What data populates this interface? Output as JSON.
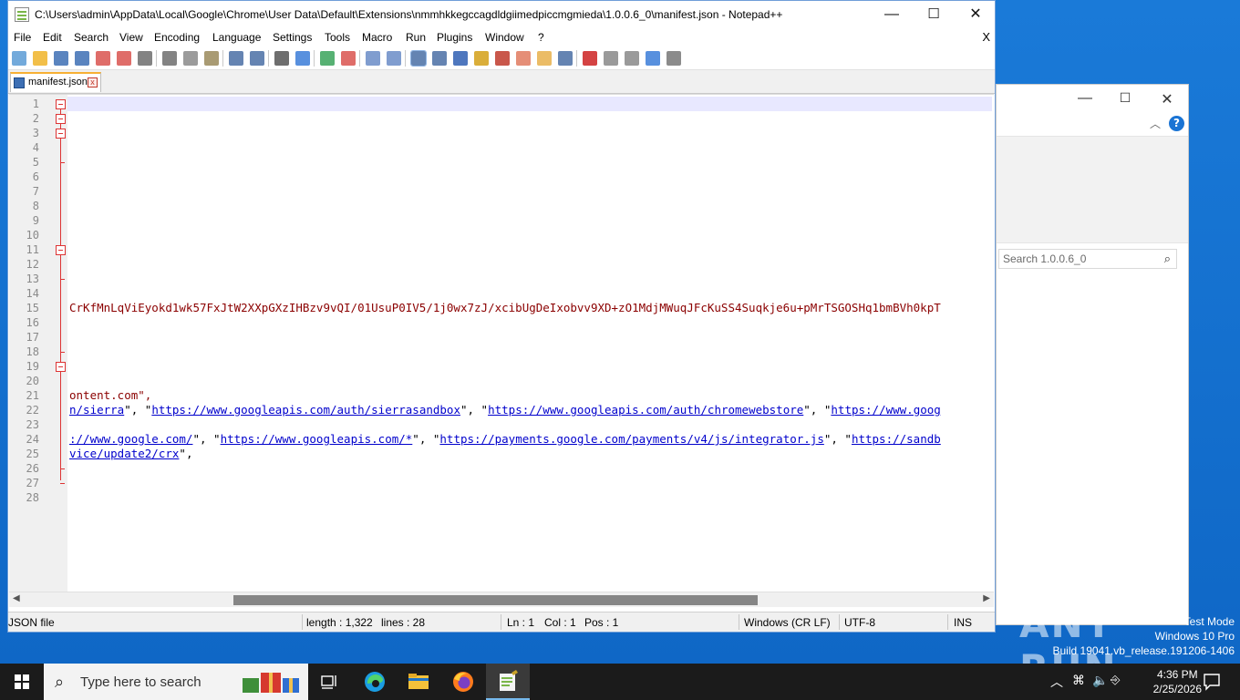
{
  "window": {
    "title": "C:\\Users\\admin\\AppData\\Local\\Google\\Chrome\\User Data\\Default\\Extensions\\nmmhkkegccagdldgiimedpiccmgmieda\\1.0.0.6_0\\manifest.json - Notepad++",
    "minimize_glyph": "—",
    "maximize_glyph": "☐",
    "close_glyph": "✕"
  },
  "menu": {
    "items": [
      "File",
      "Edit",
      "Search",
      "View",
      "Encoding",
      "Language",
      "Settings",
      "Tools",
      "Macro",
      "Run",
      "Plugins",
      "Window",
      "?"
    ],
    "close_doc": "X"
  },
  "toolbar": {
    "icons": [
      "new-file-icon",
      "open-file-icon",
      "save-icon",
      "save-all-icon",
      "close-icon",
      "close-all-icon",
      "print-icon",
      "cut-icon",
      "copy-icon",
      "paste-icon",
      "undo-icon",
      "redo-icon",
      "find-icon",
      "replace-icon",
      "zoom-in-icon",
      "zoom-out-icon",
      "sync-vertical-icon",
      "sync-horizontal-icon",
      "word-wrap-icon",
      "show-all-chars-icon",
      "indent-guide-icon",
      "user-lang-icon",
      "doc-map-icon",
      "function-list-icon",
      "folder-workspace-icon",
      "monitoring-icon",
      "record-macro-icon",
      "stop-macro-icon",
      "play-macro-icon",
      "run-macro-multiple-icon",
      "save-macro-icon"
    ]
  },
  "tab": {
    "label": "manifest.json"
  },
  "editor": {
    "line_numbers": [
      "1",
      "2",
      "3",
      "4",
      "5",
      "6",
      "7",
      "8",
      "9",
      "10",
      "11",
      "12",
      "13",
      "14",
      "15",
      "16",
      "17",
      "18",
      "19",
      "20",
      "21",
      "22",
      "23",
      "24",
      "25",
      "26",
      "27",
      "28"
    ],
    "line15": "CrKfMnLqViEyokd1wk57FxJtW2XXpGXzIHBzv9vQI/01UsuP0IV5/1j0wx7zJ/xcibUgDeIxobvv9XD+zO1MdjMWuqJFcKuSS4Suqkje6u+pMrTSGOSHq1bmBVh0kpT",
    "line21": "ontent.com\",",
    "line22": [
      {
        "t": "n/sierra",
        "k": "url"
      },
      {
        "t": "\", \"",
        "k": "op"
      },
      {
        "t": "https://www.googleapis.com/auth/sierrasandbox",
        "k": "url"
      },
      {
        "t": "\", \"",
        "k": "op"
      },
      {
        "t": "https://www.googleapis.com/auth/chromewebstore",
        "k": "url"
      },
      {
        "t": "\", \"",
        "k": "op"
      },
      {
        "t": "https://www.goog",
        "k": "url"
      }
    ],
    "line24": [
      {
        "t": "://www.google.com/",
        "k": "url"
      },
      {
        "t": "\", \"",
        "k": "op"
      },
      {
        "t": "https://www.googleapis.com/*",
        "k": "url"
      },
      {
        "t": "\", \"",
        "k": "op"
      },
      {
        "t": "https://payments.google.com/payments/v4/js/integrator.js",
        "k": "url"
      },
      {
        "t": "\", \"",
        "k": "op"
      },
      {
        "t": "https://sandb",
        "k": "url"
      }
    ],
    "line25": [
      {
        "t": "vice/update2/crx",
        "k": "url"
      },
      {
        "t": "\",",
        "k": "op"
      }
    ],
    "fold_lines": [
      1,
      2,
      3,
      11,
      19
    ]
  },
  "status": {
    "filetype": "JSON file",
    "length": "length : 1,322",
    "lines": "lines : 28",
    "ln": "Ln : 1",
    "col": "Col : 1",
    "pos": "Pos : 1",
    "eol": "Windows (CR LF)",
    "encoding": "UTF-8",
    "mode": "INS"
  },
  "explorer": {
    "search_placeholder": "Search 1.0.0.6_0",
    "help_glyph": "?"
  },
  "desktop": {
    "watermark": [
      "Test Mode",
      "Windows 10 Pro",
      "Build 19041.vb_release.191206-1406"
    ],
    "brand": "ANY RUN"
  },
  "taskbar": {
    "search_placeholder": "Type here to search",
    "time": "4:36 PM",
    "date": "2/25/2026"
  },
  "colors": {
    "string": "#8b0000",
    "url": "#0000cc",
    "fold": "#dd3333",
    "accent": "#76b9ed"
  }
}
